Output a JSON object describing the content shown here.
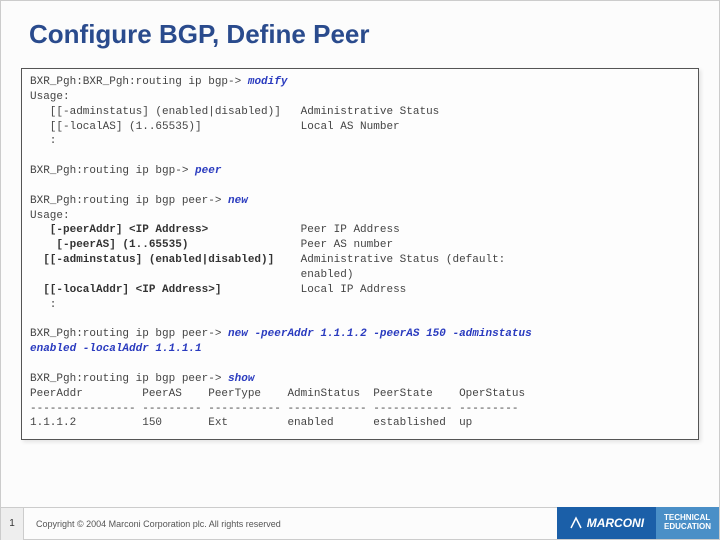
{
  "title": "Configure BGP, Define Peer",
  "cli": {
    "l1a": "BXR_Pgh:BXR_Pgh:routing ip bgp-> ",
    "l1b": "modify",
    "l2": "Usage:",
    "l3": "   [[-adminstatus] (enabled|disabled)]   Administrative Status",
    "l4": "   [[-localAS] (1..65535)]               Local AS Number",
    "l5": "   :",
    "l6": "",
    "l7a": "BXR_Pgh:routing ip bgp-> ",
    "l7b": "peer",
    "l8": "",
    "l9a": "BXR_Pgh:routing ip bgp peer-> ",
    "l9b": "new",
    "l10": "Usage:",
    "l11a": "   [-peerAddr] <IP Address>",
    "l11b": "              Peer IP Address",
    "l12a": "    [-peerAS] (1..65535)",
    "l12b": "                 Peer AS number",
    "l13a": "  [[-adminstatus] (enabled|disabled)]",
    "l13b": "    Administrative Status (default:",
    "l14": "                                         enabled)",
    "l15a": "  [[-localAddr] <IP Address>]",
    "l15b": "            Local IP Address",
    "l16": "   :",
    "l17": "",
    "l18a": "BXR_Pgh:routing ip bgp peer-> ",
    "l18b": "new -peerAddr 1.1.1.2 -peerAS 150 -adminstatus",
    "l19": "enabled -localAddr 1.1.1.1",
    "l20": "",
    "l21a": "BXR_Pgh:routing ip bgp peer-> ",
    "l21b": "show",
    "l22": "PeerAddr         PeerAS    PeerType    AdminStatus  PeerState    OperStatus",
    "l23": "---------------- --------- ----------- ------------ ------------ ---------",
    "l24": "1.1.1.2          150       Ext         enabled      established  up"
  },
  "footer": {
    "page": "1",
    "copyright": "Copyright © 2004 Marconi Corporation plc. All rights reserved",
    "brand": "MARCONI",
    "edu1": "TECHNICAL",
    "edu2": "EDUCATION"
  }
}
